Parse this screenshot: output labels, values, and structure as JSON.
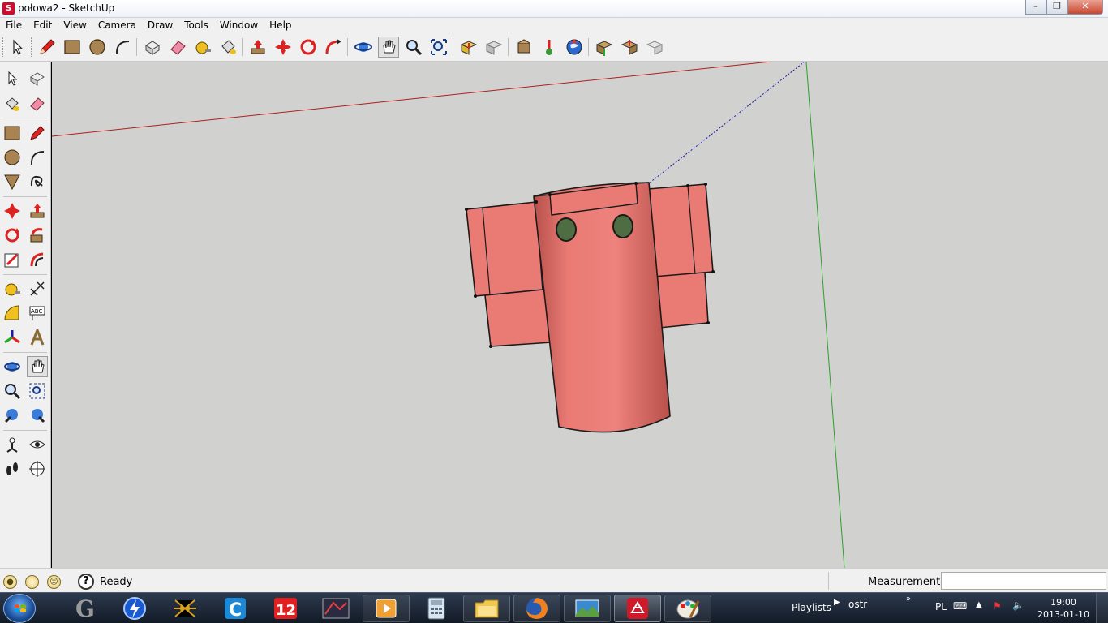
{
  "window": {
    "title": "połowa2 - SketchUp",
    "app_icon": "sketchup-icon"
  },
  "menu": [
    "File",
    "Edit",
    "View",
    "Camera",
    "Draw",
    "Tools",
    "Window",
    "Help"
  ],
  "toolbar": {
    "tools": [
      "select-icon",
      "pencil-icon",
      "rectangle-icon",
      "circle-icon",
      "arc-icon",
      "make-component-icon",
      "eraser-icon",
      "tape-measure-icon",
      "paint-bucket-icon",
      "push-pull-icon",
      "move-icon",
      "rotate-icon",
      "follow-me-icon",
      "orbit-icon",
      "pan-icon",
      "zoom-icon",
      "zoom-extents-icon",
      "get-models-icon",
      "share-model-icon",
      "components-icon",
      "add-location-icon",
      "google-earth-icon",
      "preview-earth-icon",
      "get-photo-texture-icon",
      "share-component-icon"
    ]
  },
  "status": {
    "text": "Ready",
    "measurements_label": "Measurements",
    "measurements_value": ""
  },
  "taskbar": {
    "apps": [
      "start-button",
      "g-app-icon",
      "flash-app-icon",
      "spider-app-icon",
      "c-app-icon",
      "12-app-icon",
      "sketchup-ex-app-icon",
      "media-player-icon",
      "calculator-icon",
      "explorer-icon",
      "firefox-icon",
      "photos-icon",
      "sketchup-icon",
      "paint-icon"
    ],
    "playlists_label": "Playlists",
    "playlist_name": "ostr",
    "language": "PL",
    "time": "19:00",
    "date": "2013-01-10"
  },
  "colors": {
    "model_fill": "#e97a74",
    "model_shade": "#c85a55",
    "eye_color": "#4f6d42",
    "viewport_bg": "#d1d1cf",
    "axis_red": "#b21e1e",
    "axis_green": "#2ca02c",
    "axis_blue": "#1a1ab0"
  }
}
